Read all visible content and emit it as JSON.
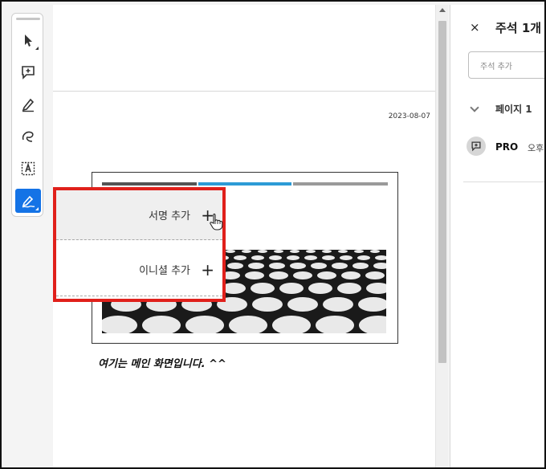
{
  "document": {
    "date": "2023-08-07",
    "caption": "여기는 메인 화면입니다. ^^"
  },
  "signature_menu": {
    "items": [
      {
        "label": "서명 추가",
        "icon": "+"
      },
      {
        "label": "이니셜 추가",
        "icon": "+"
      }
    ]
  },
  "comments_panel": {
    "close_icon": "×",
    "title": "주석 1개",
    "add_placeholder": "주석 추가",
    "page_label": "페이지 1",
    "comment": {
      "author": "PRO",
      "time": "오후"
    }
  },
  "colors": {
    "accent": "#1473e6",
    "highlight_border": "#e0201b",
    "tab_blue": "#2c9bd6"
  }
}
